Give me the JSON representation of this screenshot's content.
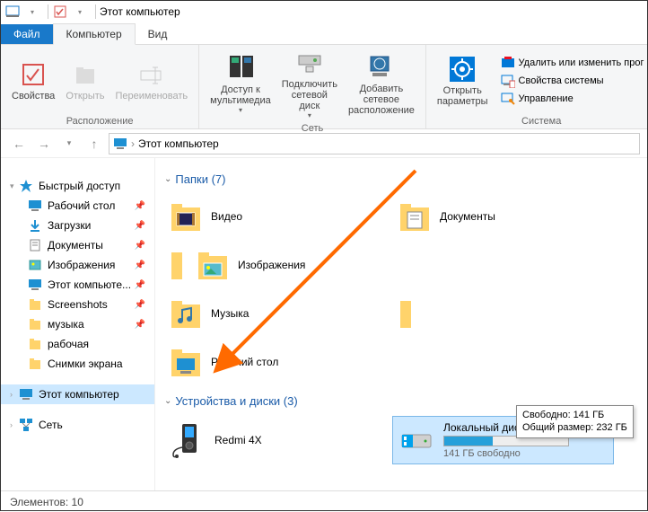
{
  "title": "Этот компьютер",
  "tabs": {
    "file": "Файл",
    "computer": "Компьютер",
    "view": "Вид"
  },
  "ribbon": {
    "group1": {
      "label": "Расположение",
      "props": "Свойства",
      "open": "Открыть",
      "rename": "Переименовать"
    },
    "group2": {
      "label": "Сеть",
      "media": "Доступ к\nмультимедиа",
      "netdrive": "Подключить\nсетевой диск",
      "addnet": "Добавить сетевое\nрасположение"
    },
    "group3": {
      "label": "Система",
      "settings": "Открыть\nпараметры",
      "uninstall": "Удалить или изменить программу",
      "sysprops": "Свойства системы",
      "manage": "Управление"
    }
  },
  "breadcrumb": {
    "label": "Этот компьютер"
  },
  "sidebar": {
    "quick": "Быстрый доступ",
    "items": [
      {
        "label": "Рабочий стол",
        "pinned": true
      },
      {
        "label": "Загрузки",
        "pinned": true
      },
      {
        "label": "Документы",
        "pinned": true
      },
      {
        "label": "Изображения",
        "pinned": true
      },
      {
        "label": "Этот компьюте...",
        "pinned": true
      },
      {
        "label": "Screenshots",
        "pinned": true
      },
      {
        "label": "музыка",
        "pinned": true
      },
      {
        "label": "рабочая",
        "pinned": false
      },
      {
        "label": "Снимки экрана",
        "pinned": false
      }
    ],
    "thispc": "Этот компьютер",
    "network": "Сеть"
  },
  "sections": {
    "folders": {
      "title": "Папки (7)",
      "items": [
        "Видео",
        "Документы",
        "Изображения",
        "Музыка",
        "Рабочий стол"
      ]
    },
    "devices": {
      "title": "Устройства и диски (3)",
      "redmi": "Redmi 4X",
      "cdrive": {
        "name": "Локальный диск (C:)",
        "free": "141 ГБ свободно",
        "fillpct": 39
      }
    }
  },
  "tooltip": {
    "line1": "Свободно: 141 ГБ",
    "line2": "Общий размер: 232 ГБ"
  },
  "status": "Элементов: 10"
}
